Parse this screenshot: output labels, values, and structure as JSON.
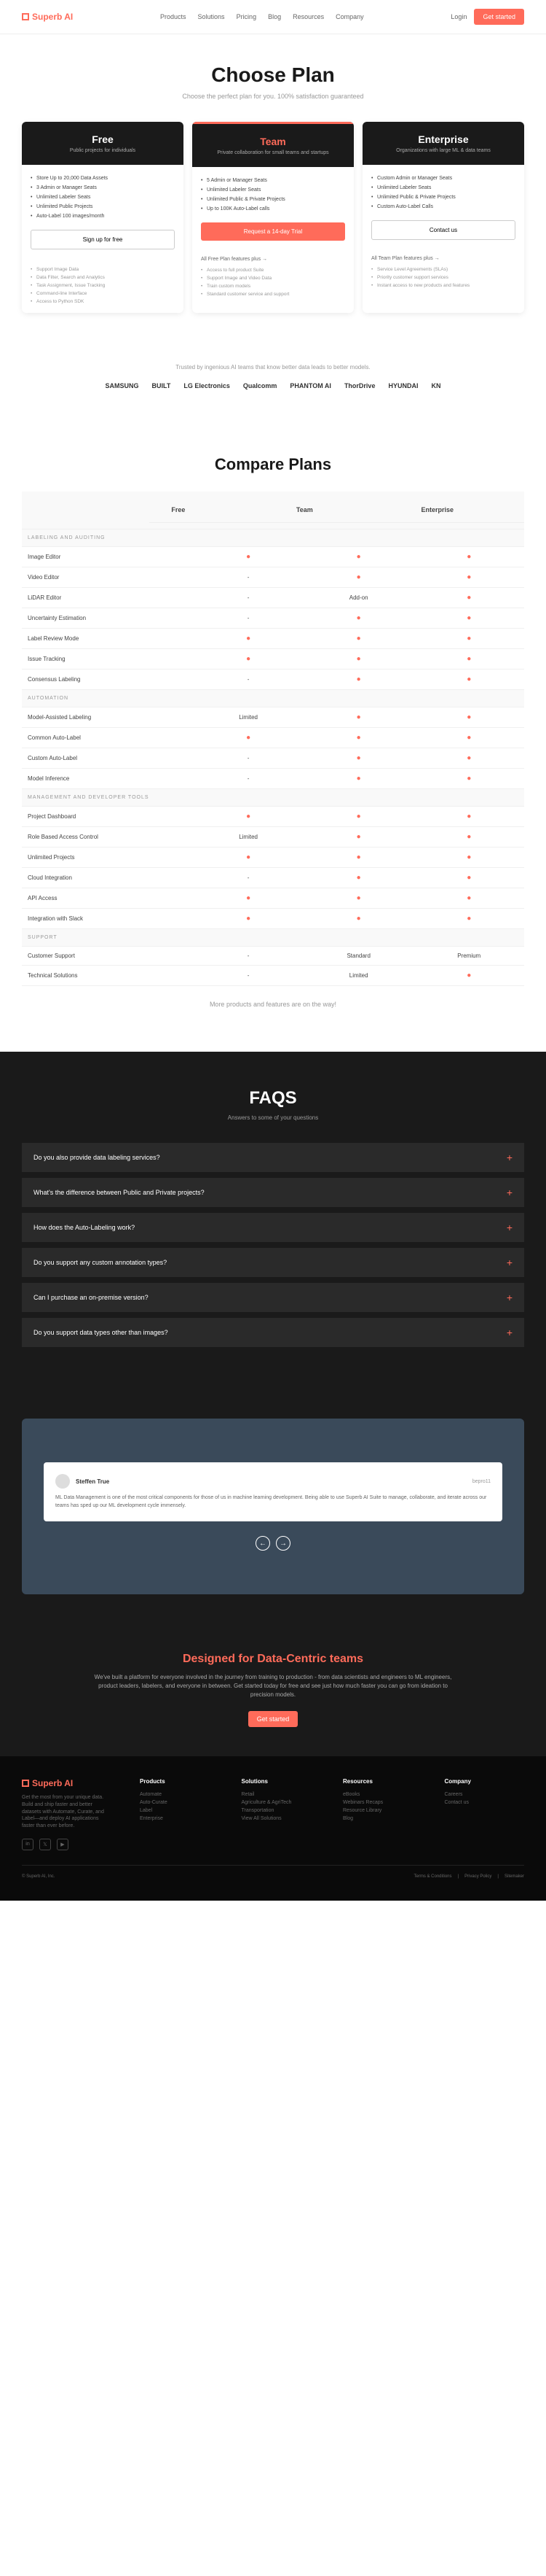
{
  "header": {
    "logo": "Superb AI",
    "nav": [
      "Products",
      "Solutions",
      "Pricing",
      "Blog",
      "Resources",
      "Company"
    ],
    "login": "Login",
    "cta": "Get started"
  },
  "hero": {
    "title": "Choose Plan",
    "subtitle": "Choose the perfect plan for you. 100% satisfaction guaranteed"
  },
  "plans": [
    {
      "name": "Free",
      "desc": "Public projects for individuals",
      "features": [
        "Store Up to 20,000 Data Assets",
        "3 Admin or Manager Seats",
        "Unlimited Labeler Seats",
        "Unlimited Public Projects",
        "Auto-Label 100 images/month"
      ],
      "btn": "Sign up for free",
      "extrasTitle": "",
      "extras": [
        "Support Image Data",
        "Data Filter, Search and Analytics",
        "Task Assignment, Issue Tracking",
        "Command-line Interface",
        "Access to Python SDK"
      ]
    },
    {
      "name": "Team",
      "desc": "Private collaboration for small teams and startups",
      "features": [
        "5 Admin or Manager Seats",
        "Unlimited Labeler Seats",
        "Unlimited Public & Private Projects",
        "Up to 100K Auto-Label calls"
      ],
      "btn": "Request a 14-day Trial",
      "extrasTitle": "All Free Plan features plus →",
      "extras": [
        "Access to full product Suite",
        "Support Image and Video Data",
        "Train custom models",
        "Standard customer service and support"
      ]
    },
    {
      "name": "Enterprise",
      "desc": "Organizations with large ML & data teams",
      "features": [
        "Custom Admin or Manager Seats",
        "Unlimited Labeler Seats",
        "Unlimited Public & Private Projects",
        "Custom Auto-Label Calls"
      ],
      "btn": "Contact us",
      "extrasTitle": "All Team Plan features plus →",
      "extras": [
        "Service Level Agreements (SLAs)",
        "Priority customer support services",
        "Instant access to new products and features"
      ]
    }
  ],
  "trusted": {
    "text": "Trusted by ingenious AI teams that know better data leads to better models.",
    "logos": [
      "SAMSUNG",
      "BUILT",
      "LG Electronics",
      "Qualcomm",
      "PHANTOM AI",
      "ThorDrive",
      "HYUNDAI",
      "KN"
    ]
  },
  "compare": {
    "title": "Compare Plans",
    "cols": [
      "Free",
      "Team",
      "Enterprise"
    ],
    "sections": [
      {
        "title": "LABELING AND AUDITING",
        "rows": [
          {
            "label": "Image Editor",
            "vals": [
              "●",
              "●",
              "●"
            ]
          },
          {
            "label": "Video Editor",
            "vals": [
              "-",
              "●",
              "●"
            ]
          },
          {
            "label": "LiDAR Editor",
            "vals": [
              "-",
              "Add-on",
              "●"
            ]
          },
          {
            "label": "Uncertainty Estimation",
            "vals": [
              "-",
              "●",
              "●"
            ]
          },
          {
            "label": "Label Review Mode",
            "vals": [
              "●",
              "●",
              "●"
            ]
          },
          {
            "label": "Issue Tracking",
            "vals": [
              "●",
              "●",
              "●"
            ]
          },
          {
            "label": "Consensus Labeling",
            "vals": [
              "-",
              "●",
              "●"
            ]
          }
        ]
      },
      {
        "title": "AUTOMATION",
        "rows": [
          {
            "label": "Model-Assisted Labeling",
            "vals": [
              "Limited",
              "●",
              "●"
            ]
          },
          {
            "label": "Common Auto-Label",
            "vals": [
              "●",
              "●",
              "●"
            ]
          },
          {
            "label": "Custom Auto-Label",
            "vals": [
              "-",
              "●",
              "●"
            ]
          },
          {
            "label": "Model Inference",
            "vals": [
              "-",
              "●",
              "●"
            ]
          }
        ]
      },
      {
        "title": "MANAGEMENT AND DEVELOPER TOOLS",
        "rows": [
          {
            "label": "Project Dashboard",
            "vals": [
              "●",
              "●",
              "●"
            ]
          },
          {
            "label": "Role Based Access Control",
            "vals": [
              "Limited",
              "●",
              "●"
            ]
          },
          {
            "label": "Unlimited Projects",
            "vals": [
              "●",
              "●",
              "●"
            ]
          },
          {
            "label": "Cloud Integration",
            "vals": [
              "-",
              "●",
              "●"
            ]
          },
          {
            "label": "API Access",
            "vals": [
              "●",
              "●",
              "●"
            ]
          },
          {
            "label": "Integration with Slack",
            "vals": [
              "●",
              "●",
              "●"
            ]
          }
        ]
      },
      {
        "title": "SUPPORT",
        "rows": [
          {
            "label": "Customer Support",
            "vals": [
              "-",
              "Standard",
              "Premium"
            ]
          },
          {
            "label": "Technical Solutions",
            "vals": [
              "-",
              "Limited",
              "●"
            ]
          }
        ]
      }
    ],
    "note": "More products and features are on the way!"
  },
  "faqs": {
    "title": "FAQS",
    "subtitle": "Answers to some of your questions",
    "items": [
      "Do you also provide data labeling services?",
      "What's the difference between Public and Private projects?",
      "How does the Auto-Labeling work?",
      "Do you support any custom annotation types?",
      "Can I purchase an on-premise version?",
      "Do you support data types other than images?"
    ]
  },
  "testimonial": {
    "name": "Steffen True",
    "company": "bepro11",
    "text": "ML Data Management is one of the most critical components for those of us in machine learning development. Being able to use Superb AI Suite to manage, collaborate, and iterate across our teams has sped up our ML development cycle immensely."
  },
  "cta": {
    "title": "Designed for Data-Centric teams",
    "text": "We've built a platform for everyone involved in the journey from training to production - from data scientists and engineers to ML engineers, product leaders, labelers, and everyone in between. Get started today for free and see just how much faster you can go from ideation to precision models.",
    "btn": "Get started"
  },
  "footer": {
    "tagline": "Get the most from your unique data. Build and ship faster and better datasets with Automate, Curate, and Label—and deploy AI applications faster than ever before.",
    "cols": [
      {
        "title": "Products",
        "items": [
          "Automate",
          "Auto-Curate",
          "Label",
          "Enterprise"
        ]
      },
      {
        "title": "Solutions",
        "items": [
          "Retail",
          "Agriculture & AgriTech",
          "Transportation",
          "View All Solutions"
        ]
      },
      {
        "title": "Resources",
        "items": [
          "eBooks",
          "Webinars Recaps",
          "Resource Library",
          "Blog"
        ]
      },
      {
        "title": "Company",
        "items": [
          "Careers",
          "Contact us"
        ]
      }
    ],
    "copyright": "© Superb AI, Inc.",
    "links": [
      "Terms & Conditions",
      "Privacy Policy",
      "Sitemaker"
    ]
  }
}
